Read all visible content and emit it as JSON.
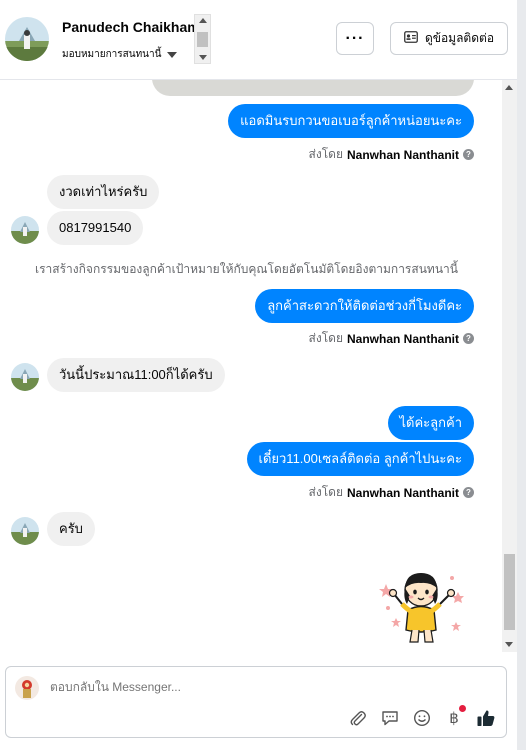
{
  "header": {
    "contact_name": "Panudech Chaikham",
    "assign_label": "มอบหมายการสนทนานี้",
    "more_label": "···",
    "contact_info_label": "ดูข้อมูลติดต่อ",
    "more_icon": "ellipsis-icon",
    "contact_icon": "id-card-icon"
  },
  "chat": {
    "outgoing_1": "แอดมินรบกวนขอเบอร์ลูกค้าหน่อยนะคะ",
    "sent_by_prefix": "ส่งโดย",
    "agent_name": "Nanwhan Nanthanit",
    "incoming_1": "งวดเท่าไหร่ครับ",
    "incoming_2": "0817991540",
    "system_note": "เราสร้างกิจกรรมของลูกค้าเป้าหมายให้กับคุณโดยอัตโนมัติโดยอิงตามการสนทนานี้",
    "outgoing_2": "ลูกค้าสะดวกให้ติดต่อช่วงกี่โมงดีคะ",
    "incoming_3": "วันนี้ประมาณ11:00ก็ได้ครับ",
    "outgoing_3": "ได้ค่ะลูกค้า",
    "outgoing_4": "เดี๋ยว11.00เซลล์ติดต่อ ลูกค้าไปนะคะ",
    "incoming_4": "ครับ",
    "sticker": "girl-sticker"
  },
  "composer": {
    "placeholder": "ตอบกลับใน Messenger...",
    "icons": [
      "paperclip-icon",
      "chat-bubble-icon",
      "smiley-icon",
      "baht-icon",
      "thumbs-up-icon"
    ]
  },
  "colors": {
    "outgoing_bubble": "#0084ff",
    "incoming_bubble": "#f0f0f0",
    "like_icon": "#1c2b33",
    "notification_dot": "#e41e3f"
  }
}
